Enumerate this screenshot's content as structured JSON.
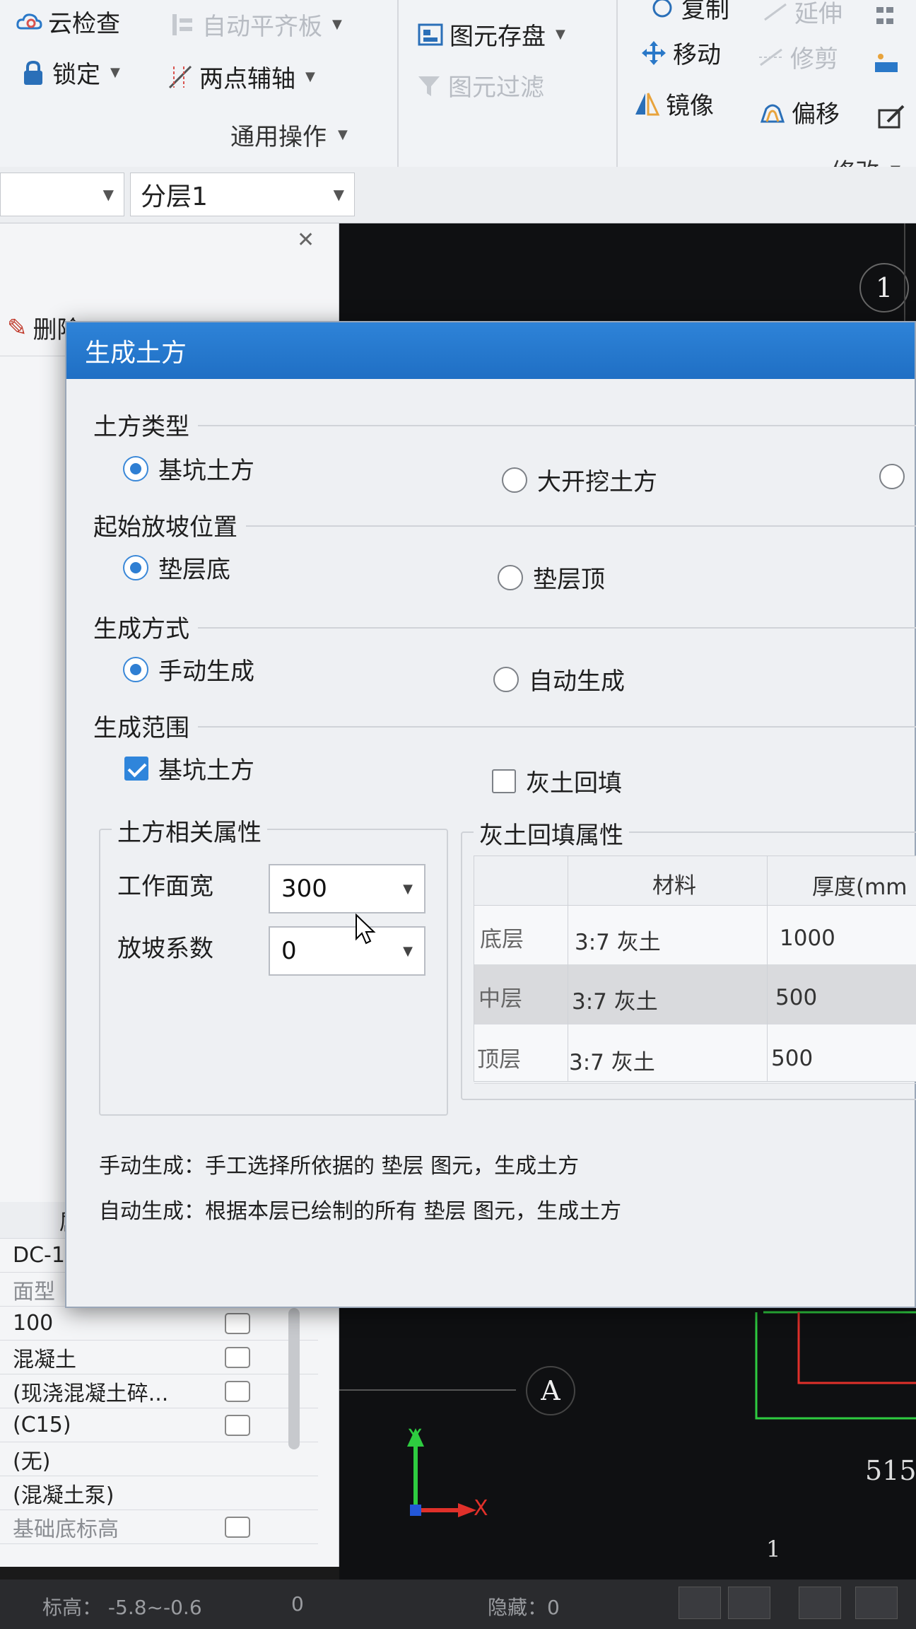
{
  "ribbon": {
    "cloud_check": "云检查",
    "auto_align": "自动平齐板",
    "element_save": "图元存盘",
    "copy": "复制",
    "extend": "延伸",
    "lock": "锁定",
    "two_point_axis": "两点辅轴",
    "element_filter": "图元过滤",
    "move": "移动",
    "trim": "修剪",
    "mirror": "镜像",
    "offset": "偏移",
    "general_ops": "通用操作",
    "modify": "修改"
  },
  "layer_bar": {
    "layer_select": "分层1"
  },
  "left_panel": {
    "delete_label": "删除",
    "header_partial": "属",
    "name_value": "DC-1",
    "rows": [
      {
        "value": "面型",
        "muted": true
      },
      {
        "value": "100"
      },
      {
        "value": "混凝土"
      },
      {
        "value": "(现浇混凝土碎..."
      },
      {
        "value": "(C15)"
      },
      {
        "value": "(无)"
      },
      {
        "value": "(混凝土泵)"
      },
      {
        "value": "基础底标高",
        "muted": true
      }
    ]
  },
  "canvas": {
    "axis_top": "1",
    "axis_a": "A",
    "axis_bottom": "1",
    "dim_text": "515",
    "ucs_x": "X",
    "ucs_y": "Y"
  },
  "status_bar": {
    "elevation": "标高：  -5.8~-0.6",
    "count": "0",
    "hidden": "隐藏：0"
  },
  "dialog": {
    "title": "生成土方",
    "earthwork_type": {
      "label": "土方类型",
      "options": [
        "基坑土方",
        "大开挖土方"
      ],
      "selected": "基坑土方"
    },
    "slope_start": {
      "label": "起始放坡位置",
      "options": [
        "垫层底",
        "垫层顶"
      ],
      "selected": "垫层底"
    },
    "gen_method": {
      "label": "生成方式",
      "options": [
        "手动生成",
        "自动生成"
      ],
      "selected": "手动生成"
    },
    "gen_scope": {
      "label": "生成范围",
      "pit": "基坑土方",
      "pit_checked": true,
      "lime": "灰土回填",
      "lime_checked": false
    },
    "earth_props": {
      "title": "土方相关属性",
      "work_width_label": "工作面宽",
      "work_width_value": "300",
      "slope_coef_label": "放坡系数",
      "slope_coef_value": "0"
    },
    "lime_props": {
      "title": "灰土回填属性",
      "col_material": "材料",
      "col_thickness": "厚度(mm",
      "rows": [
        {
          "layer": "底层",
          "material": "3:7 灰土",
          "thickness": "1000"
        },
        {
          "layer": "中层",
          "material": "3:7 灰土",
          "thickness": "500"
        },
        {
          "layer": "顶层",
          "material": "3:7 灰土",
          "thickness": "500"
        }
      ]
    },
    "note_manual": "手动生成：手工选择所依据的 垫层 图元，生成土方",
    "note_auto": "自动生成：根据本层已绘制的所有 垫层 图元，生成土方"
  },
  "colors": {
    "title_blue": "#1f6fc4",
    "radio_blue": "#2f7fd3",
    "canvas_bg": "#0f1012",
    "green_axis": "#2ecc40",
    "red_axis": "#e0302a"
  }
}
